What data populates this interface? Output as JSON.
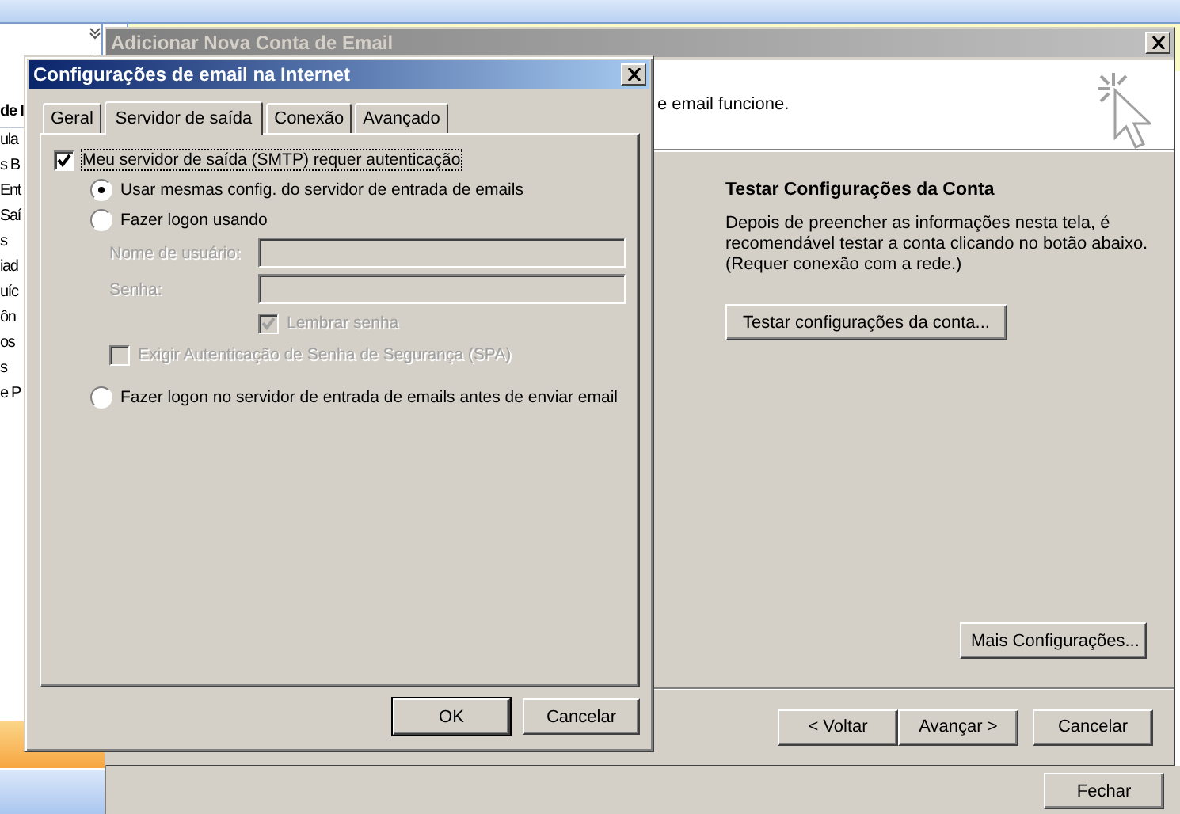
{
  "outlook": {
    "sidebar_header": "de I",
    "sidebar_items": [
      "ula",
      "s B",
      "Ent",
      "Saí",
      "s",
      "iad",
      "uíc",
      "ôn",
      "os",
      "s",
      "e P"
    ],
    "close_button": "Fechar"
  },
  "wizard": {
    "title": "Adicionar Nova Conta de Email",
    "header_text": "e email funcione.",
    "section_title": "Testar Configurações da Conta",
    "description": "Depois de preencher as informações nesta tela, é recomendável testar a conta clicando no botão abaixo. (Requer conexão com a rede.)",
    "test_button": "Testar configurações da conta...",
    "more_button": "Mais Configurações...",
    "nav_buttons": [
      "< Voltar",
      "Avançar >",
      "Cancelar"
    ]
  },
  "dialog": {
    "title": "Configurações de email na Internet",
    "tabs": [
      {
        "label": "Geral",
        "selected": false
      },
      {
        "label": "Servidor de saída",
        "selected": true
      },
      {
        "label": "Conexão",
        "selected": false
      },
      {
        "label": "Avançado",
        "selected": false
      }
    ],
    "auth": {
      "label": "Meu servidor de saída (SMTP) requer autenticação",
      "checked": true
    },
    "logon_options": [
      {
        "label": "Usar mesmas config. do servidor de entrada de emails",
        "selected": true
      },
      {
        "label": "Fazer logon usando",
        "selected": false
      },
      {
        "label": "Fazer logon no servidor de entrada de emails antes de enviar email",
        "selected": false
      }
    ],
    "credentials": {
      "disabled": true,
      "fields": [
        {
          "label": "Nome de usuário:"
        },
        {
          "label": "Senha:"
        }
      ],
      "remember": {
        "label": "Lembrar senha",
        "checked": true
      },
      "spa": {
        "label": "Exigir Autenticação de Senha de Segurança (SPA)",
        "checked": false
      }
    },
    "buttons": [
      "OK",
      "Cancelar"
    ]
  }
}
